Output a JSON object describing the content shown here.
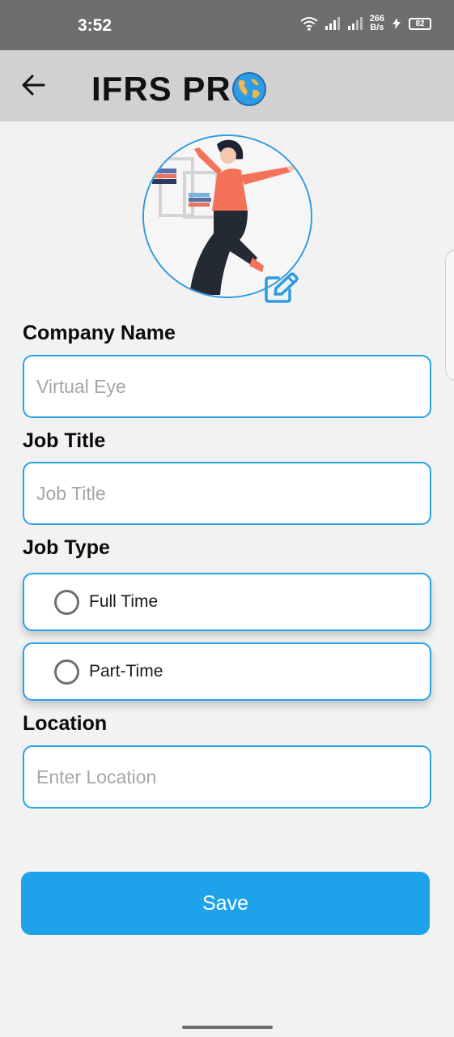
{
  "status_bar": {
    "time": "3:52",
    "net_speed_value": "266",
    "net_speed_unit": "B/s",
    "battery": "82",
    "icons": [
      "wifi-icon",
      "signal-icon",
      "signal-icon",
      "charging-icon",
      "battery-icon"
    ]
  },
  "app_bar": {
    "title": "IFRS PR",
    "back_icon": "arrow-left-icon",
    "logo_icon": "globe-icon"
  },
  "profile": {
    "avatar_icon": "avatar-illustration",
    "edit_icon": "edit-icon"
  },
  "form": {
    "company_name_label": "Company Name",
    "company_name_placeholder": "Virtual Eye",
    "job_title_label": "Job Title",
    "job_title_placeholder": "Job Title",
    "job_type_label": "Job Type",
    "job_type_options": [
      "Full Time",
      "Part-Time"
    ],
    "location_label": "Location",
    "location_placeholder": "Enter Location",
    "save_label": "Save"
  },
  "colors": {
    "accent": "#1ea3ea",
    "border": "#29a2e8",
    "app_bar": "#d1d1d1",
    "status_bar": "#6e6e6e",
    "background": "#f2f2f2"
  }
}
